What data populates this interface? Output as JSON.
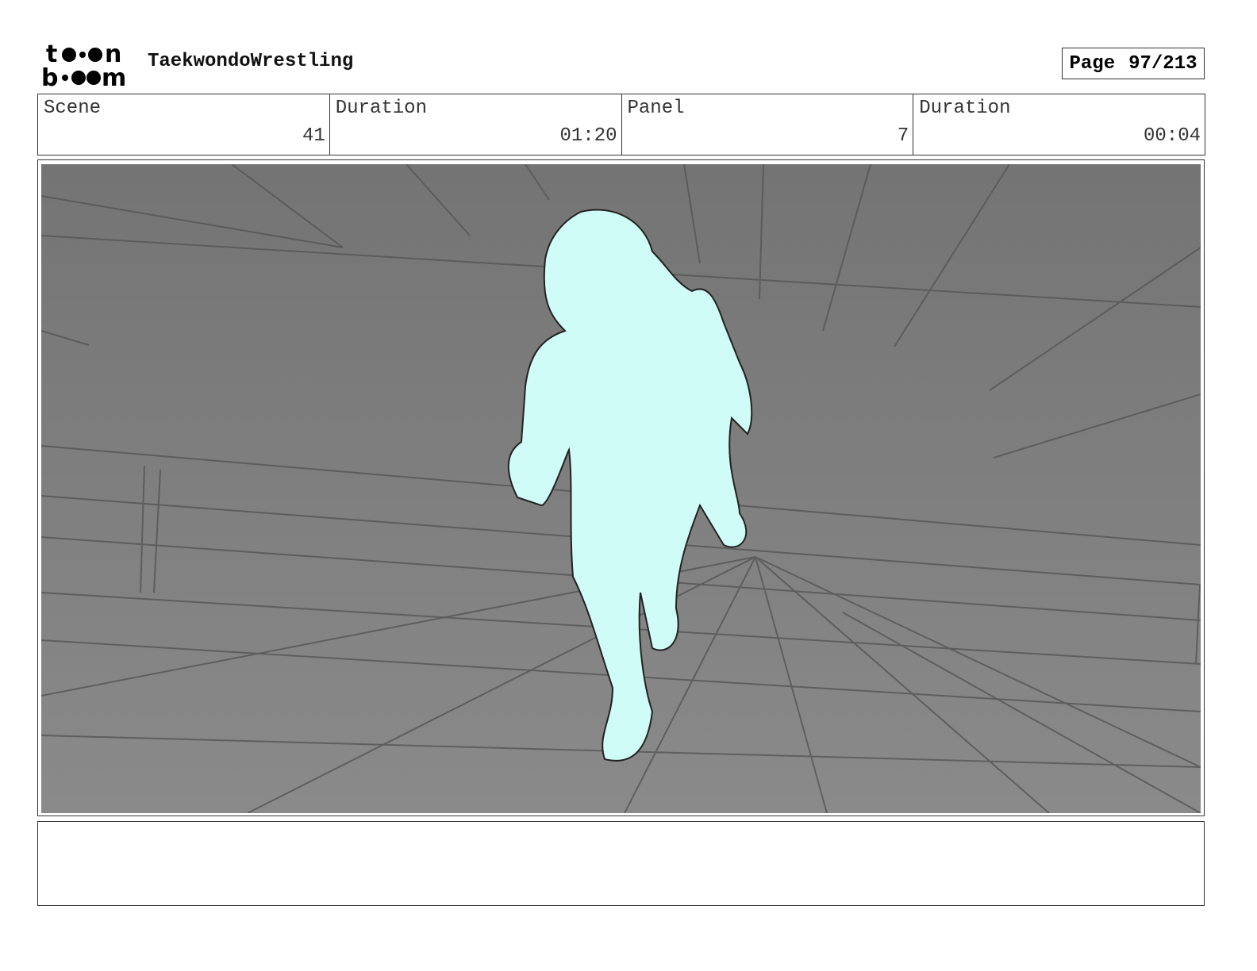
{
  "header": {
    "project_title": "TaekwondoWrestling",
    "page_label": "Page",
    "page_value": "97/213"
  },
  "fields": [
    {
      "label": "Scene",
      "value": "41"
    },
    {
      "label": "Duration",
      "value": "01:20"
    },
    {
      "label": "Panel",
      "value": "7"
    },
    {
      "label": "Duration",
      "value": "00:04"
    }
  ],
  "colors": {
    "background": "#7a7a7a",
    "character_fill": "#cffcf6"
  }
}
